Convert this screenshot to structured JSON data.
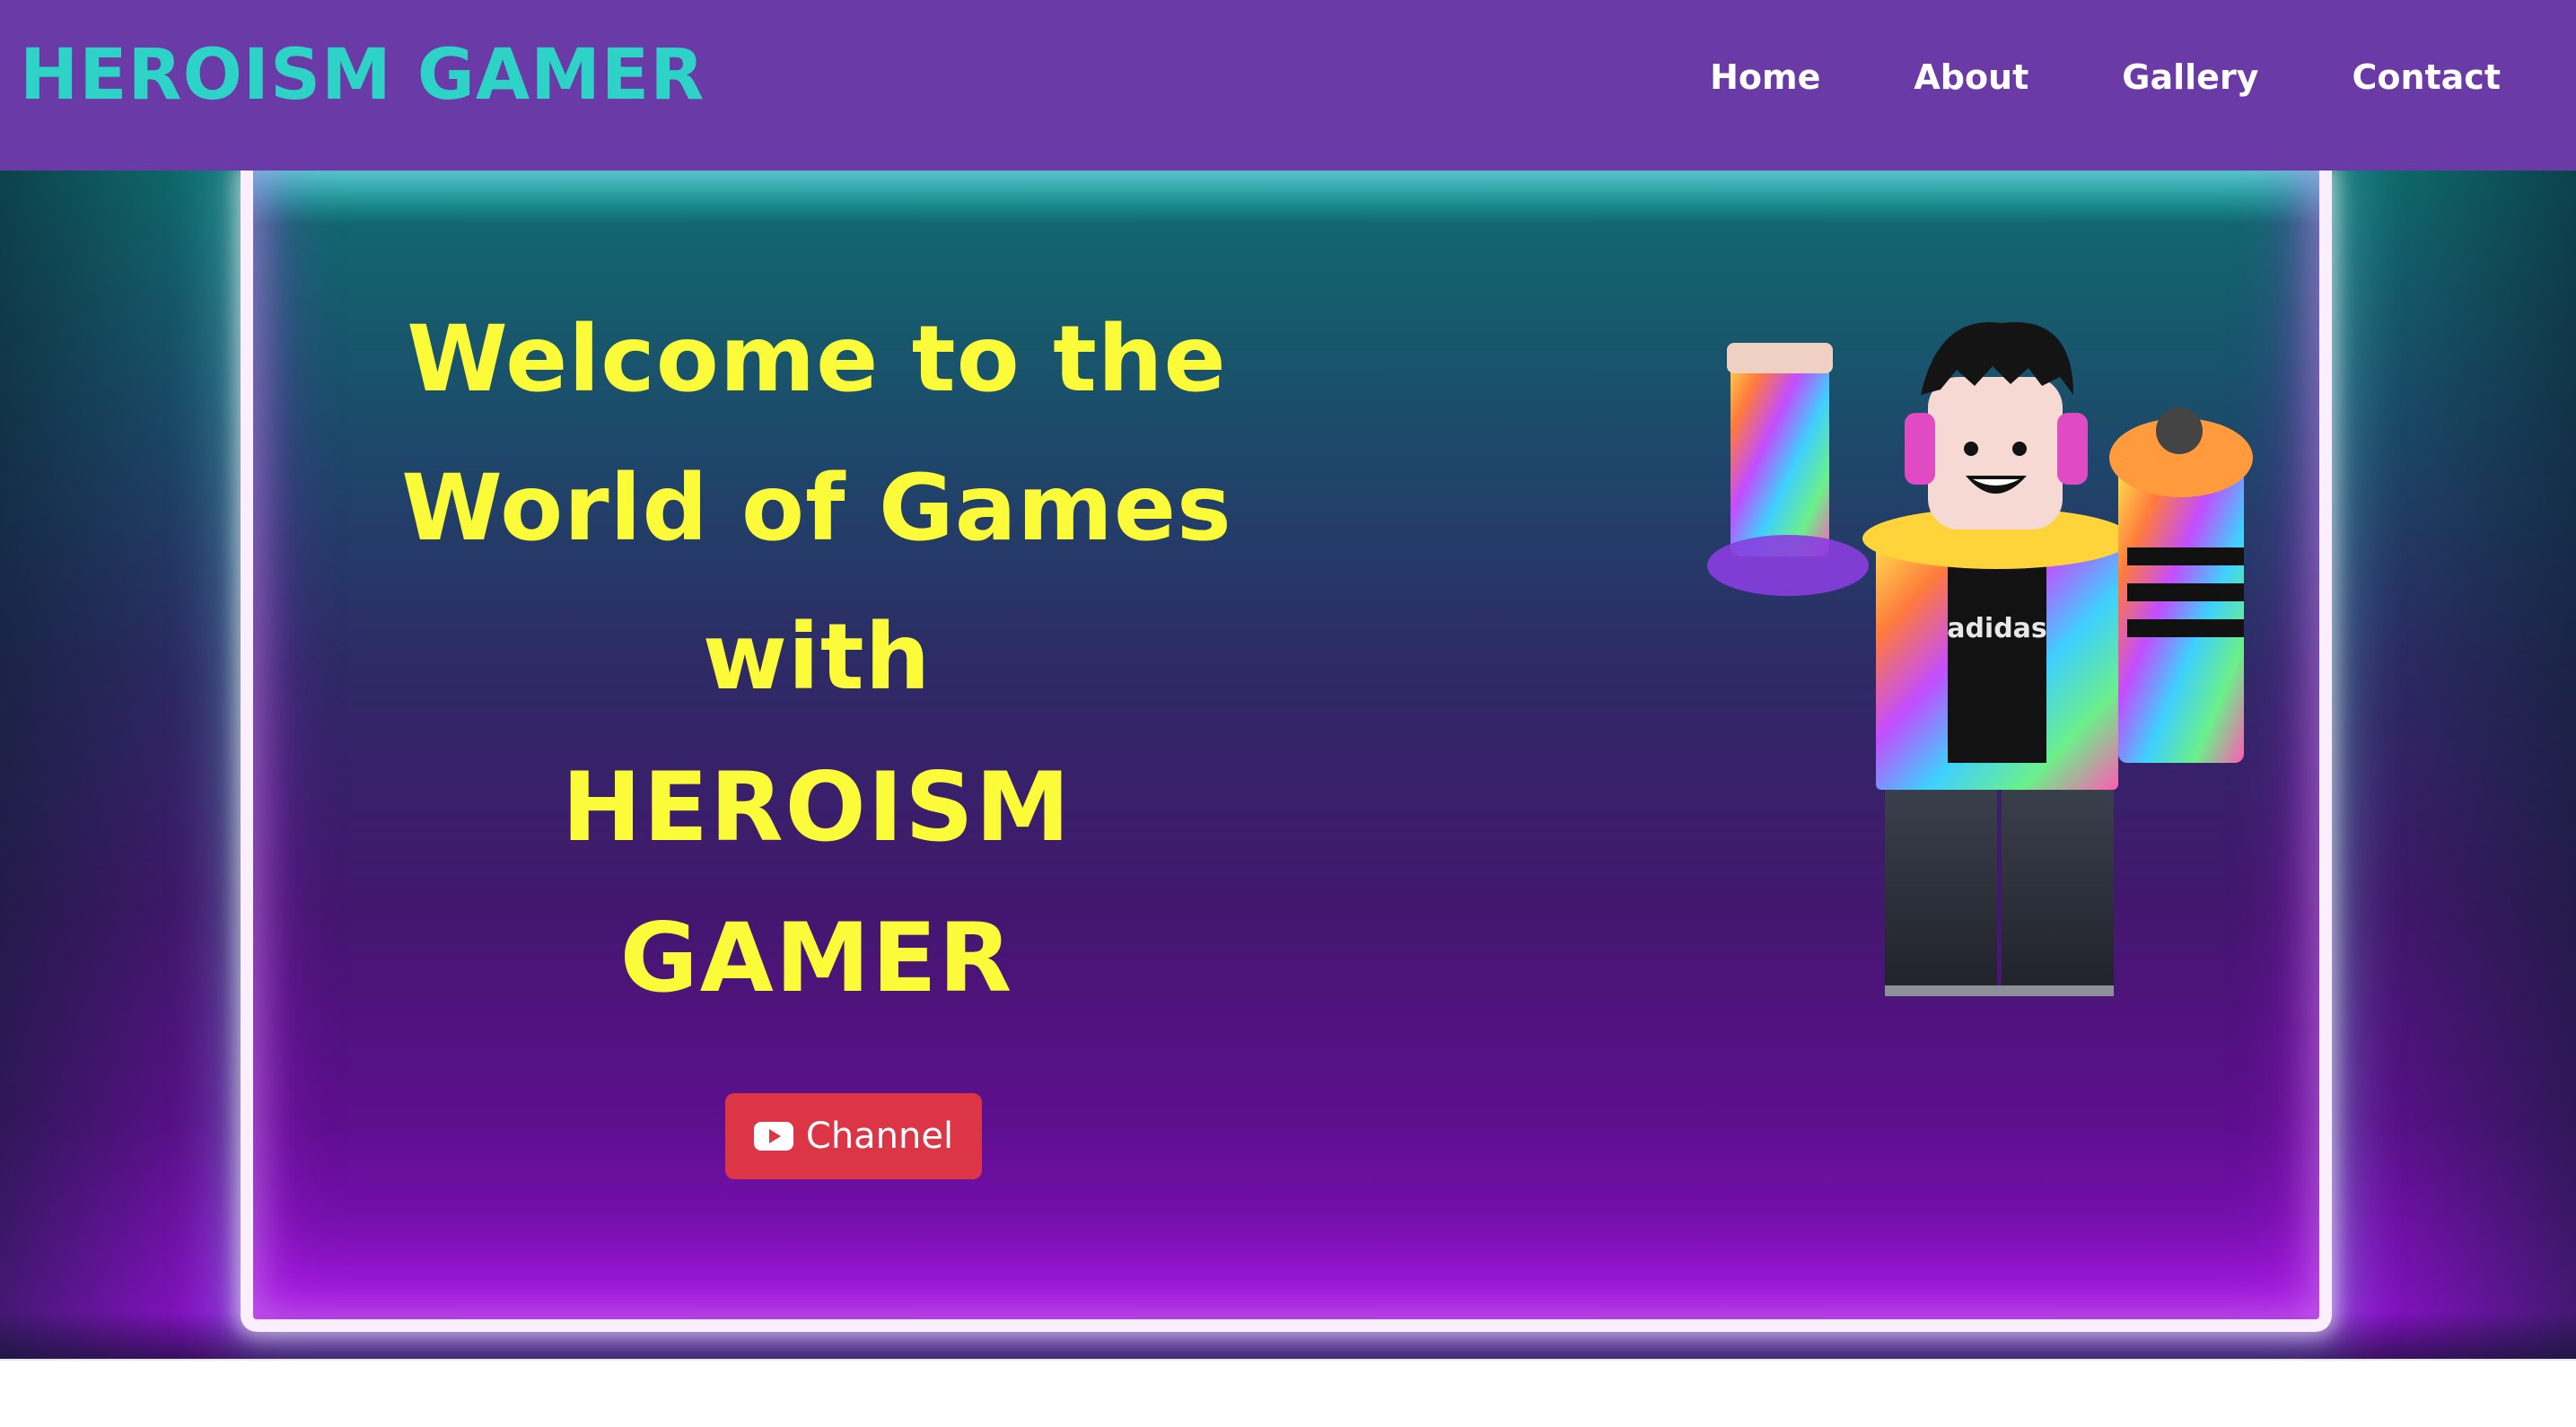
{
  "navbar": {
    "brand": "HEROISM GAMER",
    "links": [
      {
        "label": "Home"
      },
      {
        "label": "About"
      },
      {
        "label": "Gallery"
      },
      {
        "label": "Contact"
      }
    ],
    "background": "#6a3aa6",
    "brand_color": "#2ed3c8"
  },
  "hero": {
    "heading_lines": [
      "Welcome to the",
      "World of Games",
      "with"
    ],
    "name_lines": [
      "HEROISM",
      "GAMER"
    ],
    "heading_color": "#fcfb3a",
    "channel_button": {
      "label": "Channel",
      "icon": "youtube-icon",
      "color": "#dc3545"
    },
    "avatar": {
      "icon": "roblox-avatar-image"
    }
  }
}
